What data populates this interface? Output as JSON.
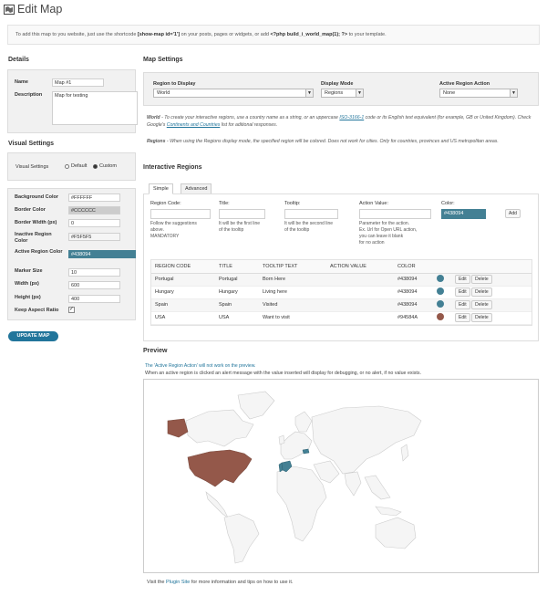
{
  "header": {
    "title": "Edit Map",
    "notice_prefix": "To add this map to you website, just use the shortcode",
    "shortcode": "[show-map id='1']",
    "notice_middle": "on your posts, pages or widgets, or add",
    "php_code": "<?php build_i_world_map(1); ?>",
    "notice_suffix": "to your template."
  },
  "details": {
    "heading": "Details",
    "name_label": "Name",
    "name_value": "Map #1",
    "description_label": "Description",
    "description_value": "Map for testing"
  },
  "visual_settings": {
    "heading": "Visual Settings",
    "label": "Visual Settings",
    "option_default": "Default",
    "option_custom": "Custom",
    "fields": [
      {
        "label": "Background Color",
        "value": "#FFFFFF"
      },
      {
        "label": "Border Color",
        "value": "#CCCCCC"
      },
      {
        "label": "Border Width (px)",
        "value": "0"
      },
      {
        "label": "Inactive Region Color",
        "value": "#F5F5F5"
      },
      {
        "label": "Active Region Color",
        "value": "#438094"
      },
      {
        "label": "Marker Size",
        "value": "10"
      },
      {
        "label": "Width (px)",
        "value": "600"
      },
      {
        "label": "Height (px)",
        "value": "400"
      }
    ],
    "keep_aspect_label": "Keep Aspect Ratio",
    "update_button": "UPDATE MAP"
  },
  "map_settings": {
    "heading": "Map Settings",
    "region_label": "Region to Display",
    "region_value": "World",
    "mode_label": "Display Mode",
    "mode_value": "Regions",
    "action_label": "Active Region Action",
    "action_value": "None",
    "help1_title": "World",
    "help1_text": "- To create your interactive regions, use a country name as a string, or an uppercase",
    "help1_link": "ISO-3166-1",
    "help1_text2": "code or its English text equivalent (for example, GB or United Kingdom). Check Google's",
    "help1_link2": "Continents and Countries",
    "help1_text3": "list for aditional responses.",
    "help2_title": "Regions",
    "help2_text": "- When using the Regions display mode, the specified region will be colored. Does not work for cities. Only for countries, provinces and US metropolitan areas."
  },
  "interactive_regions": {
    "heading": "Interactive Regions",
    "tabs": [
      "Simple",
      "Advanced"
    ],
    "region_code_label": "Region Code:",
    "region_code_help1": "Follow the suggestions",
    "region_code_help2": "above.",
    "region_code_help3": "MANDATORY",
    "title_label": "Title:",
    "title_help1": "It will be the first line",
    "title_help2": "of the tooltip",
    "tooltip_label": "Tooltip:",
    "tooltip_help1": "It will be the second line",
    "tooltip_help2": "of the tooltip",
    "action_value_label": "Action Value:",
    "action_help1": "Parameter for the action.",
    "action_help2": "Ex. Url for Open URL action,",
    "action_help3": "you can leave it blank",
    "action_help4": "for no action",
    "color_label": "Color:",
    "color_value": "#438094",
    "add_button": "Add",
    "columns": [
      "REGION CODE",
      "TITLE",
      "TOOLTIP TEXT",
      "ACTION VALUE",
      "COLOR"
    ],
    "rows": [
      {
        "code": "Portugal",
        "title": "Portugal",
        "tooltip": "Born Here",
        "action": "",
        "color": "#438094"
      },
      {
        "code": "Hungary",
        "title": "Hungary",
        "tooltip": "Living here",
        "action": "",
        "color": "#438094"
      },
      {
        "code": "Spain",
        "title": "Spain",
        "tooltip": "Visited",
        "action": "",
        "color": "#438094"
      },
      {
        "code": "USA",
        "title": "USA",
        "tooltip": "Want to visit",
        "action": "",
        "color": "#94584A"
      }
    ],
    "edit_label": "Edit",
    "delete_label": "Delete"
  },
  "preview": {
    "heading": "Preview",
    "note1": "The 'Active Region Action' will not work on the preview.",
    "note2": "When an active region is clicked an alert message with the value inserted will display for debugging, or no alert, if no value exists.",
    "footer_prefix": "Visit the",
    "footer_link": "Plugin Site",
    "footer_suffix": "for more information and tips on how to use it."
  },
  "colors": {
    "active": "#438094",
    "usa": "#94584A",
    "inactive": "#F5F5F5",
    "button": "#21759b"
  }
}
